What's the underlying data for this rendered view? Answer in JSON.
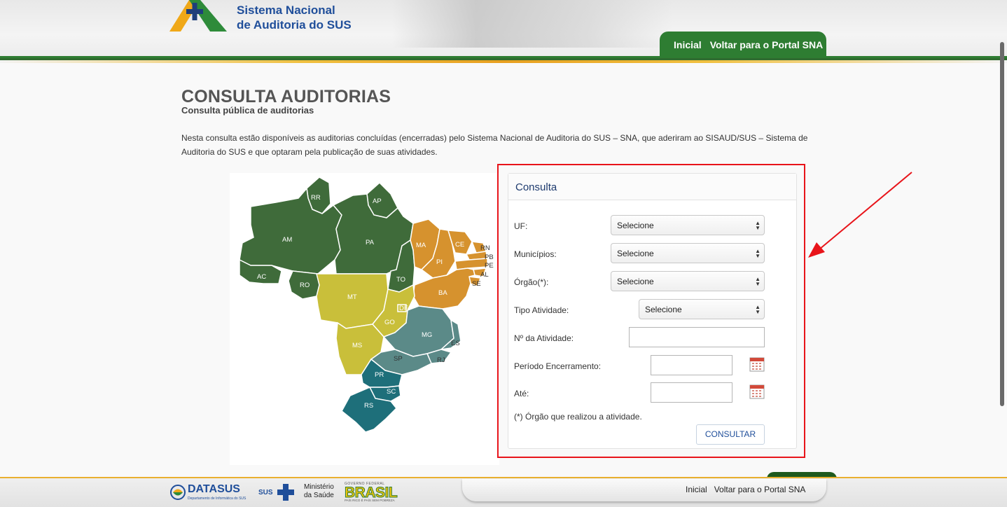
{
  "header": {
    "site_title_line1": "Sistema Nacional",
    "site_title_line2": "de Auditoria do SUS",
    "nav": [
      "Inicial",
      "Voltar para o Portal SNA"
    ]
  },
  "page": {
    "title": "CONSULTA AUDITORIAS",
    "subtitle": "Consulta pública de auditorias",
    "intro_line1": "Nesta consulta estão disponíveis as auditorias concluídas (encerradas) pelo Sistema Nacional de Auditoria do SUS – SNA, que aderiram ao SISAUD/SUS – Sistema de",
    "intro_line2": "Auditoria do SUS e que optaram pela publicação de suas atividades."
  },
  "map": {
    "states": [
      "RR",
      "AP",
      "AM",
      "PA",
      "MA",
      "CE",
      "RN",
      "PB",
      "PE",
      "AL",
      "SE",
      "PI",
      "AC",
      "RO",
      "TO",
      "BA",
      "MT",
      "DF",
      "GO",
      "MG",
      "ES",
      "MS",
      "SP",
      "RJ",
      "PR",
      "SC",
      "RS"
    ],
    "colors": {
      "north": "#3f6b3a",
      "northeast": "#d6922e",
      "center_west": "#c9bf3a",
      "southeast": "#5b8a88",
      "south": "#1e6f7a"
    }
  },
  "form": {
    "header": "Consulta",
    "uf_label": "UF:",
    "uf_value": "Selecione",
    "municipios_label": "Municípios:",
    "municipios_value": "Selecione",
    "orgao_label": "Órgão(*):",
    "orgao_value": "Selecione",
    "tipo_label": "Tipo Atividade:",
    "tipo_value": "Selecione",
    "numero_label": "Nº da Atividade:",
    "numero_value": "",
    "periodo_label": "Período Encerramento:",
    "periodo_value": "",
    "ate_label": "Até:",
    "ate_value": "",
    "note": "(*) Órgão que realizou a atividade.",
    "submit": "CONSULTAR"
  },
  "footer": {
    "datasus": "DATASUS",
    "datasus_sub": "Departamento de Informática do SUS",
    "sus": "SUS",
    "ministerio_line1": "Ministério",
    "ministerio_line2": "da Saúde",
    "brasil_top": "GOVERNO FEDERAL",
    "brasil": "BRASIL",
    "brasil_bottom": "PAÍS RICO É PAÍS SEM POBREZA",
    "nav": [
      "Inicial",
      "Voltar para o Portal SNA"
    ]
  }
}
